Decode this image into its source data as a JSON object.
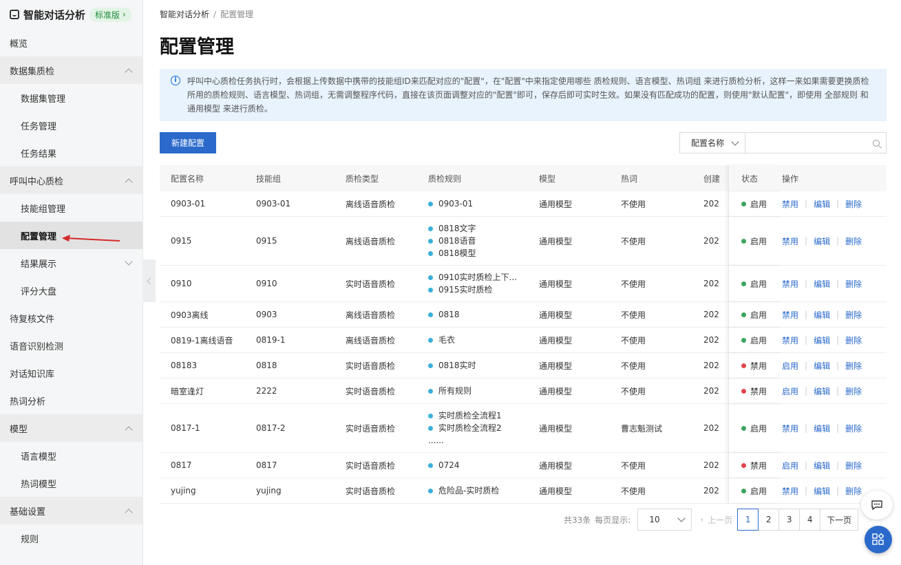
{
  "brand": {
    "name": "智能对话分析",
    "edition": "标准版"
  },
  "sidebar": {
    "items": [
      {
        "label": "概览",
        "type": "top"
      },
      {
        "label": "数据集质检",
        "type": "group",
        "open": true
      },
      {
        "label": "数据集管理",
        "type": "sub"
      },
      {
        "label": "任务管理",
        "type": "sub"
      },
      {
        "label": "任务结果",
        "type": "sub"
      },
      {
        "label": "呼叫中心质检",
        "type": "group",
        "open": true
      },
      {
        "label": "技能组管理",
        "type": "sub"
      },
      {
        "label": "配置管理",
        "type": "sub",
        "active": true
      },
      {
        "label": "结果展示",
        "type": "sub-group",
        "open": false
      },
      {
        "label": "评分大盘",
        "type": "sub"
      },
      {
        "label": "待复核文件",
        "type": "top"
      },
      {
        "label": "语音识别检测",
        "type": "top"
      },
      {
        "label": "对话知识库",
        "type": "top"
      },
      {
        "label": "热词分析",
        "type": "top"
      },
      {
        "label": "模型",
        "type": "group",
        "open": true
      },
      {
        "label": "语言模型",
        "type": "sub"
      },
      {
        "label": "热词模型",
        "type": "sub"
      },
      {
        "label": "基础设置",
        "type": "group",
        "open": true
      },
      {
        "label": "规则",
        "type": "sub"
      }
    ]
  },
  "breadcrumb": {
    "root": "智能对话分析",
    "sep": "/",
    "current": "配置管理"
  },
  "page_title": "配置管理",
  "notice": "呼叫中心质检任务执行时，会根据上传数据中携带的技能组ID来匹配对应的\"配置\"，在\"配置\"中来指定使用哪些 质检规则、语言模型、热词组 来进行质检分析，这样一来如果需要更换质检所用的质检规则、语言模型、热词组，无需调整程序代码，直接在该页面调整对应的\"配置\"即可，保存后即可实时生效。如果没有匹配成功的配置，则使用\"默认配置\"，即使用 全部规则 和通用模型 来进行质检。",
  "toolbar": {
    "new_button": "新建配置",
    "filter_field": "配置名称",
    "search_placeholder": ""
  },
  "table": {
    "headers": [
      "配置名称",
      "技能组",
      "质检类型",
      "质检规则",
      "模型",
      "热词",
      "创建",
      "状态",
      "操作"
    ],
    "rows": [
      {
        "name": "0903-01",
        "group": "0903-01",
        "type": "离线语音质检",
        "rules": [
          "0903-01"
        ],
        "more": "",
        "model": "通用模型",
        "hot": "不使用",
        "created": "202",
        "status": "启用",
        "toggle": "禁用",
        "edit": "编辑",
        "del": "删除",
        "enabled": true
      },
      {
        "name": "0915",
        "group": "0915",
        "type": "离线语音质检",
        "rules": [
          "0818文字",
          "0818语音",
          "0818模型"
        ],
        "more": "",
        "model": "通用模型",
        "hot": "不使用",
        "created": "202",
        "status": "启用",
        "toggle": "禁用",
        "edit": "编辑",
        "del": "删除",
        "enabled": true
      },
      {
        "name": "0910",
        "group": "0910",
        "type": "实时语音质检",
        "rules": [
          "0910实时质检上下...",
          "0915实时质检"
        ],
        "more": "",
        "model": "通用模型",
        "hot": "不使用",
        "created": "202",
        "status": "启用",
        "toggle": "禁用",
        "edit": "编辑",
        "del": "删除",
        "enabled": true
      },
      {
        "name": "0903离线",
        "group": "0903",
        "type": "离线语音质检",
        "rules": [
          "0818"
        ],
        "more": "",
        "model": "通用模型",
        "hot": "不使用",
        "created": "202",
        "status": "启用",
        "toggle": "禁用",
        "edit": "编辑",
        "del": "删除",
        "enabled": true
      },
      {
        "name": "0819-1离线语音",
        "group": "0819-1",
        "type": "离线语音质检",
        "rules": [
          "毛衣"
        ],
        "more": "",
        "model": "通用模型",
        "hot": "不使用",
        "created": "202",
        "status": "启用",
        "toggle": "禁用",
        "edit": "编辑",
        "del": "删除",
        "enabled": true
      },
      {
        "name": "08183",
        "group": "0818",
        "type": "实时语音质检",
        "rules": [
          "0818实时"
        ],
        "more": "",
        "model": "通用模型",
        "hot": "不使用",
        "created": "202",
        "status": "禁用",
        "toggle": "启用",
        "edit": "编辑",
        "del": "删除",
        "enabled": false
      },
      {
        "name": "暗室逢灯",
        "group": "2222",
        "type": "实时语音质检",
        "rules": [
          "所有规则"
        ],
        "more": "",
        "model": "通用模型",
        "hot": "不使用",
        "created": "202",
        "status": "禁用",
        "toggle": "启用",
        "edit": "编辑",
        "del": "删除",
        "enabled": false
      },
      {
        "name": "0817-1",
        "group": "0817-2",
        "type": "实时语音质检",
        "rules": [
          "实时质检全流程1",
          "实时质检全流程2"
        ],
        "more": "......",
        "model": "通用模型",
        "hot": "曹志魁测试",
        "created": "202",
        "status": "启用",
        "toggle": "禁用",
        "edit": "编辑",
        "del": "删除",
        "enabled": true
      },
      {
        "name": "0817",
        "group": "0817",
        "type": "实时语音质检",
        "rules": [
          "0724"
        ],
        "more": "",
        "model": "通用模型",
        "hot": "不使用",
        "created": "202",
        "status": "禁用",
        "toggle": "启用",
        "edit": "编辑",
        "del": "删除",
        "enabled": false
      },
      {
        "name": "yujing",
        "group": "yujing",
        "type": "实时语音质检",
        "rules": [
          "危险品-实时质检"
        ],
        "more": "",
        "model": "通用模型",
        "hot": "不使用",
        "created": "202",
        "status": "启用",
        "toggle": "禁用",
        "edit": "编辑",
        "del": "删除",
        "enabled": true
      }
    ]
  },
  "pagination": {
    "total": "共33条",
    "per_page_label": "每页显示:",
    "per_page": "10",
    "prev": "上一页",
    "pages": [
      "1",
      "2",
      "3",
      "4"
    ],
    "current": "1",
    "next": "下一页"
  },
  "colors": {
    "primary": "#2b6acb",
    "enabled": "#3ba55c",
    "disabled": "#e0454a",
    "rule_dot": "#3ab0d8",
    "notice_bg": "#e8f3fd"
  },
  "icons": {
    "logo": "brand-logo-icon",
    "info": "info-icon",
    "search": "search-icon",
    "chat": "chat-icon",
    "apps": "apps-icon"
  }
}
